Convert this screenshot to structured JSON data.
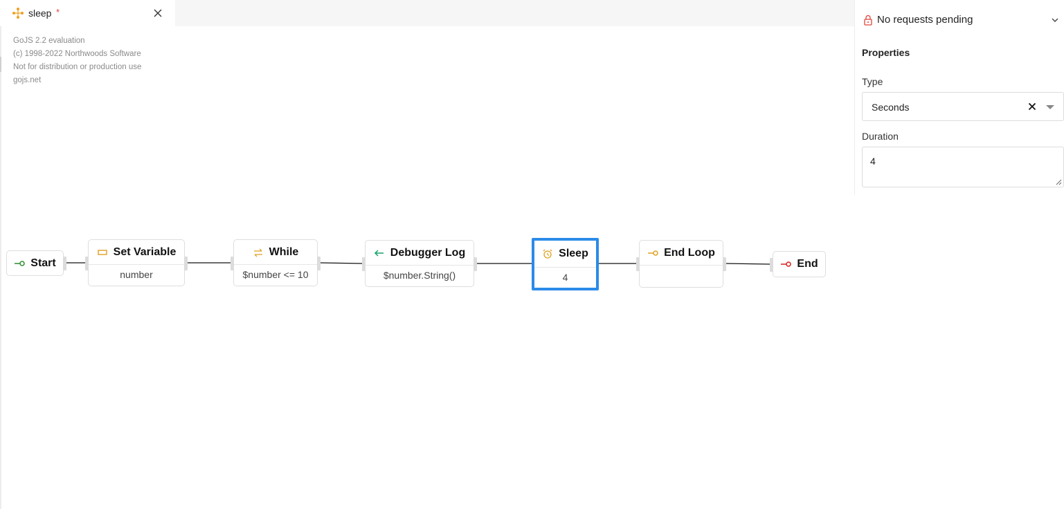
{
  "tab": {
    "title": "sleep",
    "dirty_mark": "*"
  },
  "watermark": {
    "line1": "GoJS 2.2 evaluation",
    "line2": "(c) 1998-2022 Northwoods Software",
    "line3": "Not for distribution or production use",
    "line4": "gojs.net"
  },
  "diagram": {
    "nodes": {
      "start": {
        "title": "Start",
        "icon": "start-circle-icon"
      },
      "set_variable": {
        "title": "Set Variable",
        "value": "number",
        "icon": "variable-rect-icon"
      },
      "while": {
        "title": "While",
        "value": "$number <= 10",
        "icon": "loop-arrows-icon"
      },
      "debugger_log": {
        "title": "Debugger Log",
        "value": "$number.String()",
        "icon": "return-arrow-icon"
      },
      "sleep": {
        "title": "Sleep",
        "value": "4",
        "icon": "alarm-clock-icon",
        "selected": true
      },
      "end_loop": {
        "title": "End Loop",
        "value": "",
        "icon": "end-loop-icon"
      },
      "end": {
        "title": "End",
        "icon": "end-circle-icon"
      }
    }
  },
  "panel": {
    "requests": "No requests pending",
    "properties_title": "Properties",
    "type_label": "Type",
    "type_value": "Seconds",
    "duration_label": "Duration",
    "duration_value": "4"
  },
  "colors": {
    "selection": "#2b8be8",
    "start": "#2e8b2e",
    "end": "#d81e1e",
    "accent_orange": "#e0a020",
    "debug_green": "#17a06a",
    "lock_red": "#e0453a"
  }
}
